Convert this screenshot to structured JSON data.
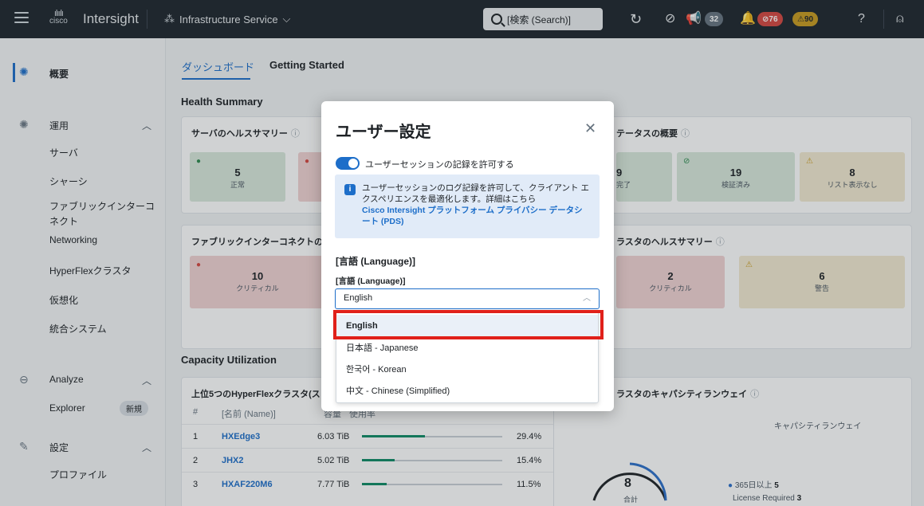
{
  "topbar": {
    "logo": "cisco",
    "app_name": "Intersight",
    "service": "Infrastructure Service",
    "search_placeholder": "[検索 (Search)]",
    "announce_count": "32",
    "alarm_critical": "76",
    "alarm_warning": "90"
  },
  "sidebar": {
    "overview": "概要",
    "operate": "運用",
    "servers": "サーバ",
    "chassis": "シャーシ",
    "fabric_line1": "ファブリックインターコ",
    "fabric_line2": "ネクト",
    "networking": "Networking",
    "hyperflex": "HyperFlexクラスタ",
    "virtualization": "仮想化",
    "integrated": "統合システム",
    "analyze": "Analyze",
    "explorer": "Explorer",
    "explorer_badge": "新規",
    "settings": "設定",
    "profiles": "プロファイル"
  },
  "main": {
    "tab_dashboard": "ダッシュボード",
    "tab_getting_started": "Getting Started",
    "health_summary": "Health Summary",
    "server_health_title": "サーバのヘルスサマリー",
    "server_health": [
      {
        "value": "5",
        "label": "正常"
      }
    ],
    "fabric_title": "ファブリックインターコネクトの",
    "fabric_critical": {
      "value": "10",
      "label": "クリティカル"
    },
    "status_overview_title": "テータスの概要",
    "status_tiles": [
      {
        "value": "9",
        "label": "完了"
      },
      {
        "value": "19",
        "label": "検証済み"
      },
      {
        "value": "8",
        "label": "リスト表示なし"
      }
    ],
    "cluster_health_title": "ラスタのヘルスサマリー",
    "cluster_tiles": [
      {
        "value": "2",
        "label": "クリティカル"
      },
      {
        "value": "6",
        "label": "警告"
      }
    ],
    "capacity_title": "Capacity Utilization",
    "top5_title": "上位5つのHyperFlexクラスタ(ス",
    "top5_headers": {
      "num": "#",
      "name": "[名前 (Name)]",
      "capacity": "容量",
      "usage": "使用率"
    },
    "top5_rows": [
      {
        "num": "1",
        "name": "HXEdge3",
        "cap": "6.03 TiB",
        "pct": "29.4%",
        "frac": 0.294
      },
      {
        "num": "2",
        "name": "JHX2",
        "cap": "5.02 TiB",
        "pct": "15.4%",
        "frac": 0.154
      },
      {
        "num": "3",
        "name": "HXAF220M6",
        "cap": "7.77 TiB",
        "pct": "11.5%",
        "frac": 0.115
      }
    ],
    "runway_title": "ラスタのキャパシティランウェイ",
    "runway_subtitle": "キャパシティランウェイ",
    "runway_total": "8",
    "runway_total_label": "合計",
    "runway_legend1_label": "365日以上",
    "runway_legend1_value": "5",
    "runway_legend2_label": "License Required",
    "runway_legend2_value": "3"
  },
  "modal": {
    "title": "ユーザー設定",
    "toggle_label": "ユーザーセッションの記録を許可する",
    "info_text": "ユーザーセッションのログ記録を許可して、クライアント エクスペリエンスを最適化します。詳細はこちら",
    "info_link": "Cisco Intersight プラットフォーム プライバシー データシート (PDS)",
    "language_heading": "[言語 (Language)]",
    "language_field_label": "[言語 (Language)]",
    "language_value": "English",
    "options": [
      "English",
      "日本語 - Japanese",
      "한국어 - Korean",
      "中文 - Chinese (Simplified)"
    ]
  }
}
